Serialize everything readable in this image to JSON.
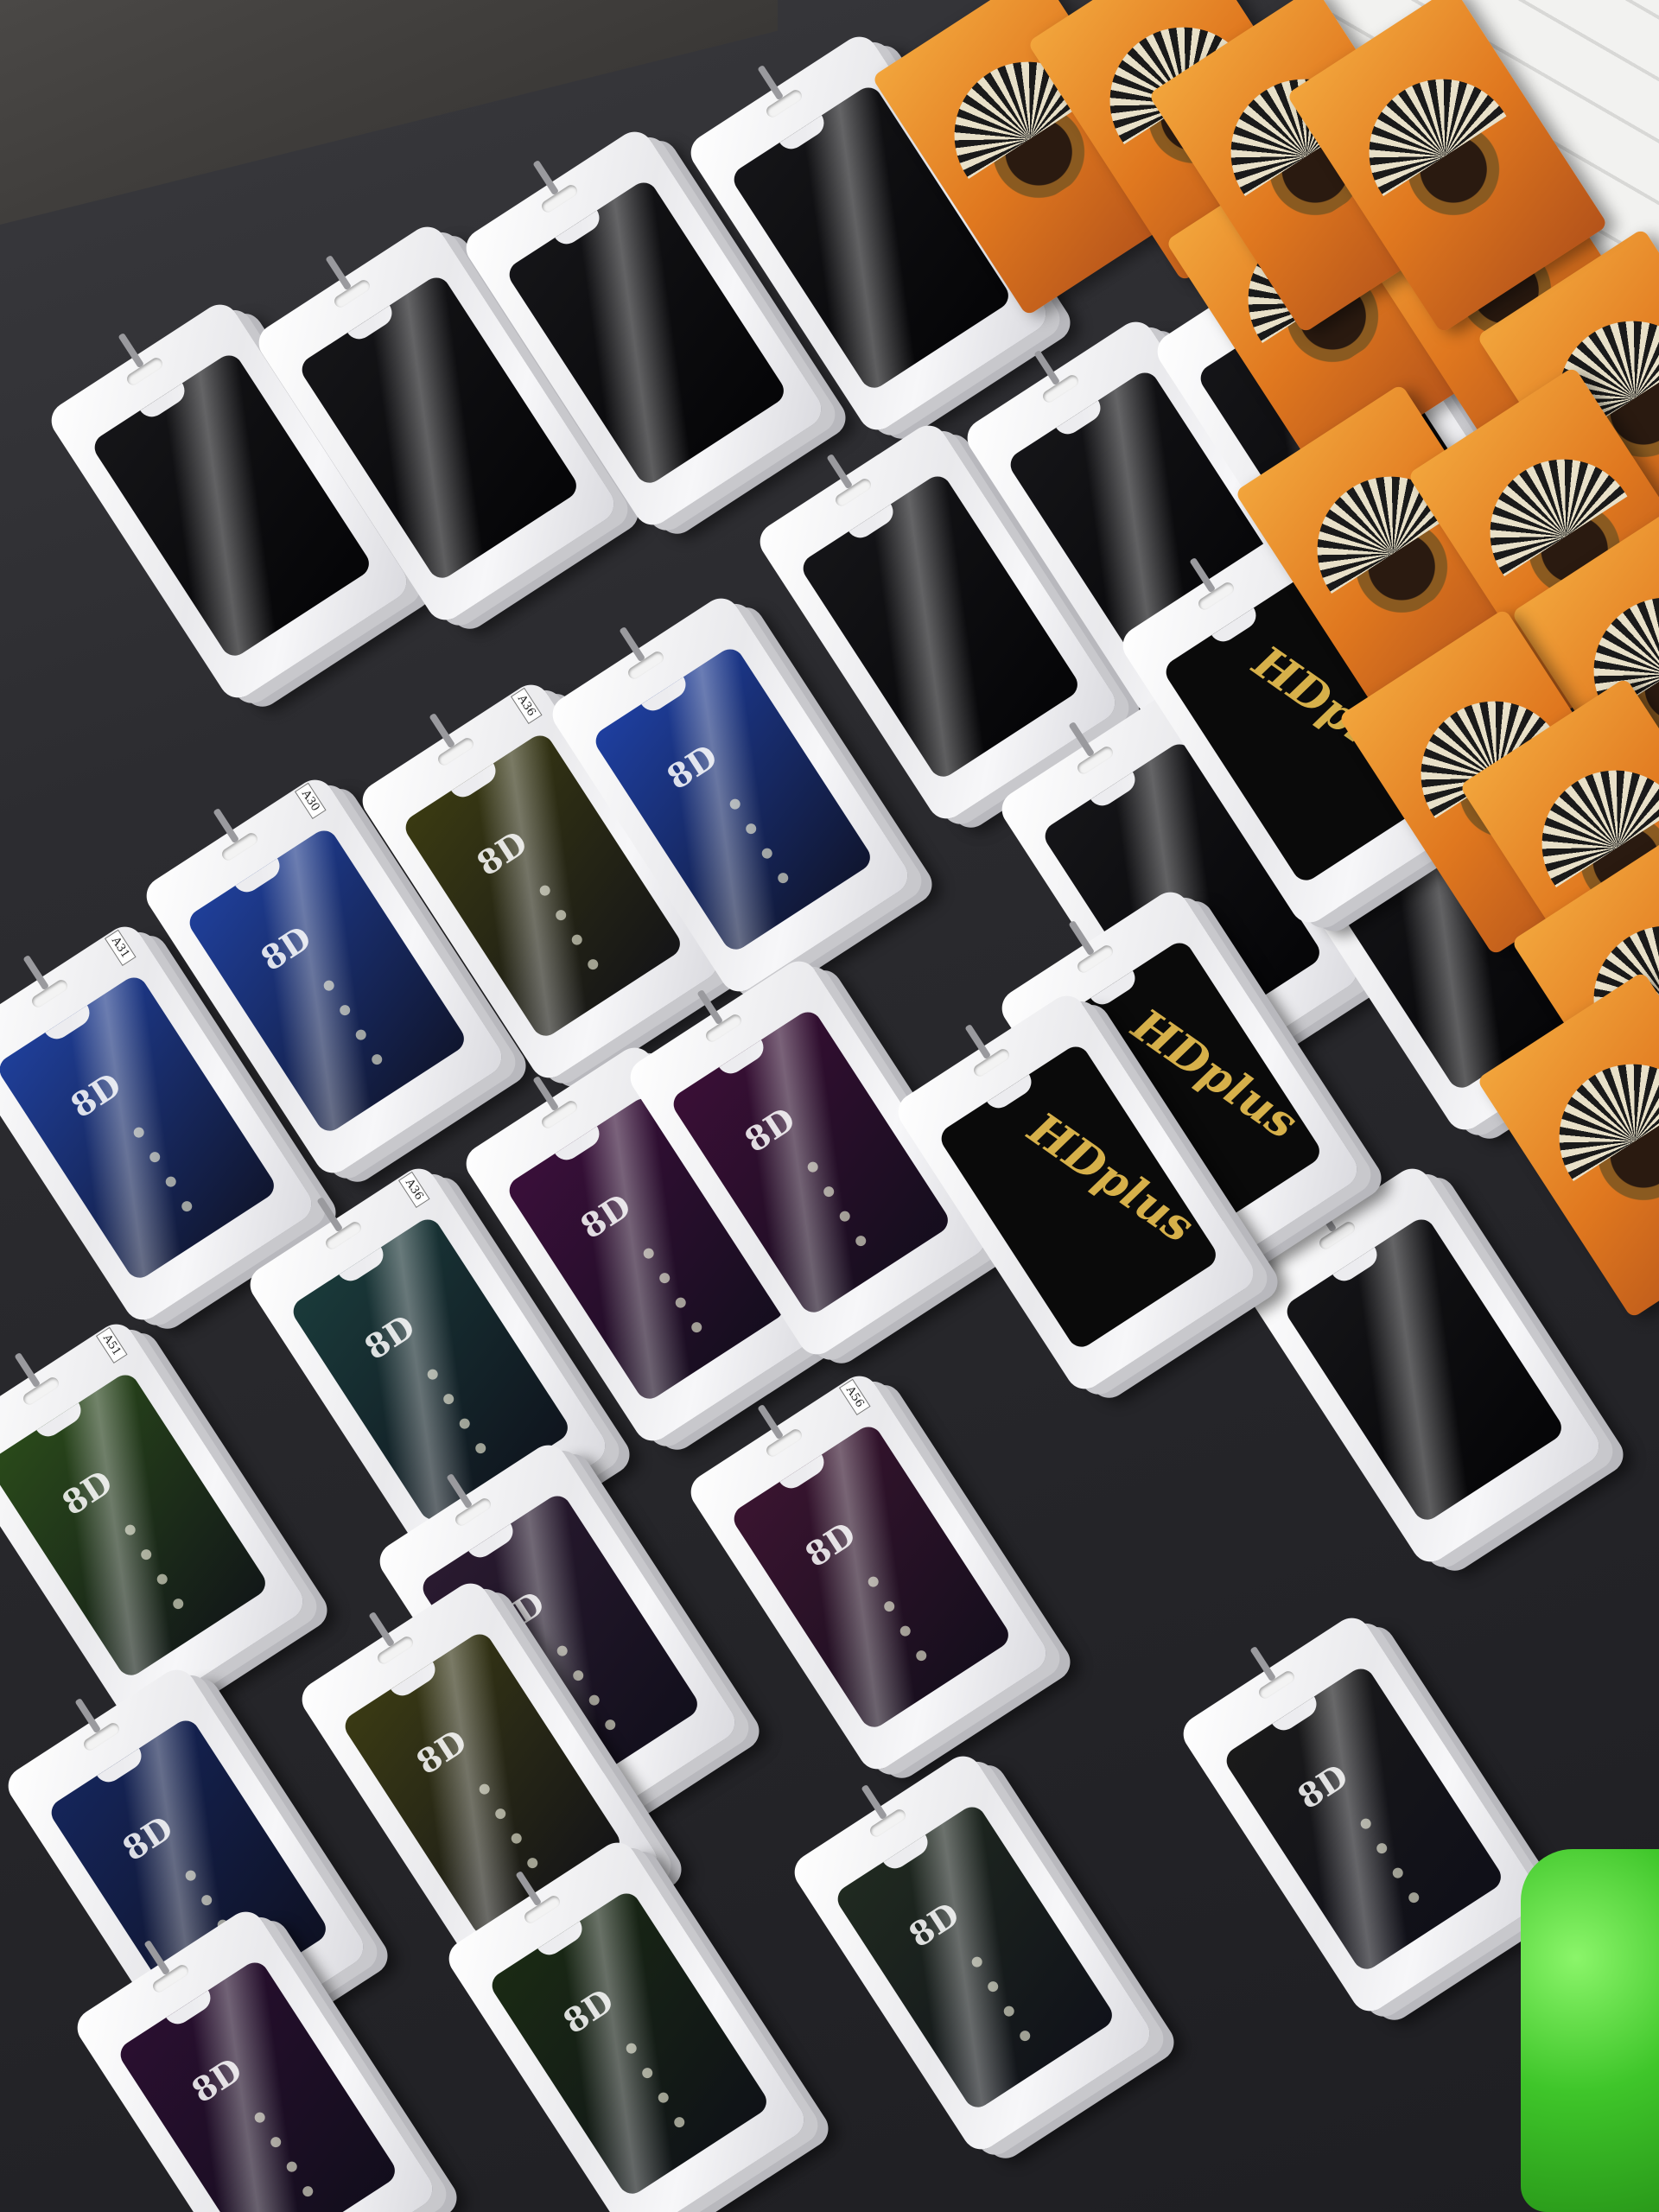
{
  "scene": {
    "description_hidden": false
  },
  "colors": {
    "wall": "#3a3836",
    "bag_green": "#3fc62a",
    "orange_pack": "#e0781f"
  },
  "packs": [
    {
      "label": "8D",
      "tag": "A31",
      "color": "#1f3f9a"
    },
    {
      "label": "8D",
      "tag": "A30",
      "color": "#1f3f9a"
    },
    {
      "label": "8D",
      "tag": "A36",
      "color": "#3a3a12"
    },
    {
      "label": "8D",
      "tag": "",
      "color": "#1e3fa0"
    },
    {
      "label": "8D",
      "tag": "A51",
      "color": "#2a4a1a"
    },
    {
      "label": "8D",
      "tag": "A36",
      "color": "#1a3a3a"
    },
    {
      "label": "8D",
      "tag": "",
      "color": "#3a0f3a"
    },
    {
      "label": "8D",
      "tag": "",
      "color": "#15255a"
    },
    {
      "label": "8D",
      "tag": "",
      "color": "#2a1a30"
    },
    {
      "label": "8D",
      "tag": "",
      "color": "#3a0f36"
    },
    {
      "label": "8D",
      "tag": "",
      "color": "#3a3a14"
    },
    {
      "label": "8D",
      "tag": "A56",
      "color": "#3a1430"
    },
    {
      "label": "8D",
      "tag": "",
      "color": "#2a0f30"
    },
    {
      "label": "8D",
      "tag": "",
      "color": "#1a2a14"
    },
    {
      "label": "8D",
      "tag": "",
      "color": "#202a20"
    },
    {
      "label": "8D",
      "tag": "",
      "color": "#1a1a1a"
    }
  ],
  "brand_packs": [
    {
      "brand": "HDplus"
    },
    {
      "brand": "HDplus"
    },
    {
      "brand": "HDplus"
    }
  ],
  "dark_packs": 10,
  "orange_packs": 14
}
